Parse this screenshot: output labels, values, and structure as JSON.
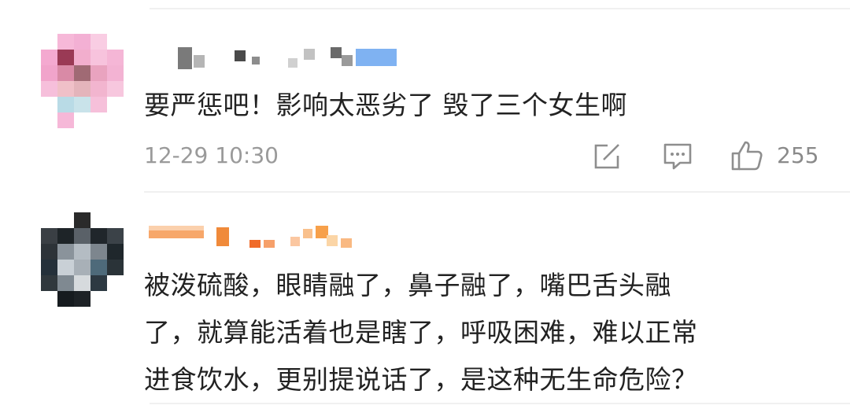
{
  "comments": [
    {
      "username": "",
      "text": "要严惩吧！影响太恶劣了 毁了三个女生啊",
      "timestamp": "12-29 10:30",
      "likes": "255",
      "actions": [
        "share-icon",
        "comment-icon",
        "thumbs-up-icon"
      ]
    },
    {
      "username": "",
      "lines": [
        "被泼硫酸，眼睛融了，鼻子融了，嘴巴舌头融",
        "了，就算能活着也是瞎了，呼吸困难，难以正常",
        "进食饮水，更别提说话了，是这种无生命危险？"
      ]
    }
  ],
  "colors": {
    "text": "#222222",
    "meta": "#9a9a9a",
    "divider": "#f0f0f0"
  }
}
